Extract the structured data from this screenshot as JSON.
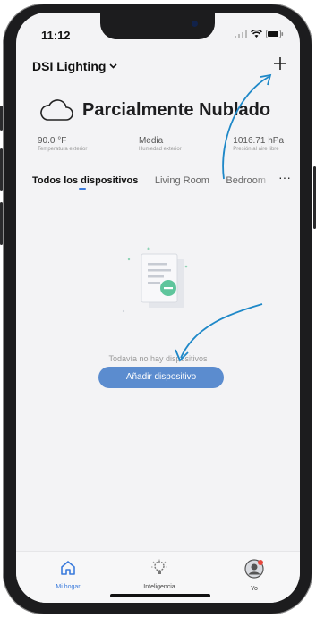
{
  "status_bar": {
    "time": "11:12"
  },
  "header": {
    "home_name": "DSI Lighting"
  },
  "weather": {
    "condition": "Parcialmente Nublado",
    "stats": [
      {
        "value": "90.0 °F",
        "label": "Temperatura exterior"
      },
      {
        "value": "Media",
        "label": "Humedad exterior"
      },
      {
        "value": "1016.71 hPa",
        "label": "Presión al aire libre"
      }
    ]
  },
  "tabs": [
    "Todos los dispositivos",
    "Living Room",
    "Bedroom"
  ],
  "empty": {
    "message": "Todavía no hay dispositivos",
    "add_button": "Añadir dispositivo"
  },
  "tabbar": {
    "items": [
      {
        "label": "Mi hogar"
      },
      {
        "label": "Inteligencia"
      },
      {
        "label": "Yo"
      }
    ]
  },
  "colors": {
    "accent": "#3b7bdc",
    "button": "#5b8ccf",
    "annotation_arrow": "#1e88c8"
  }
}
